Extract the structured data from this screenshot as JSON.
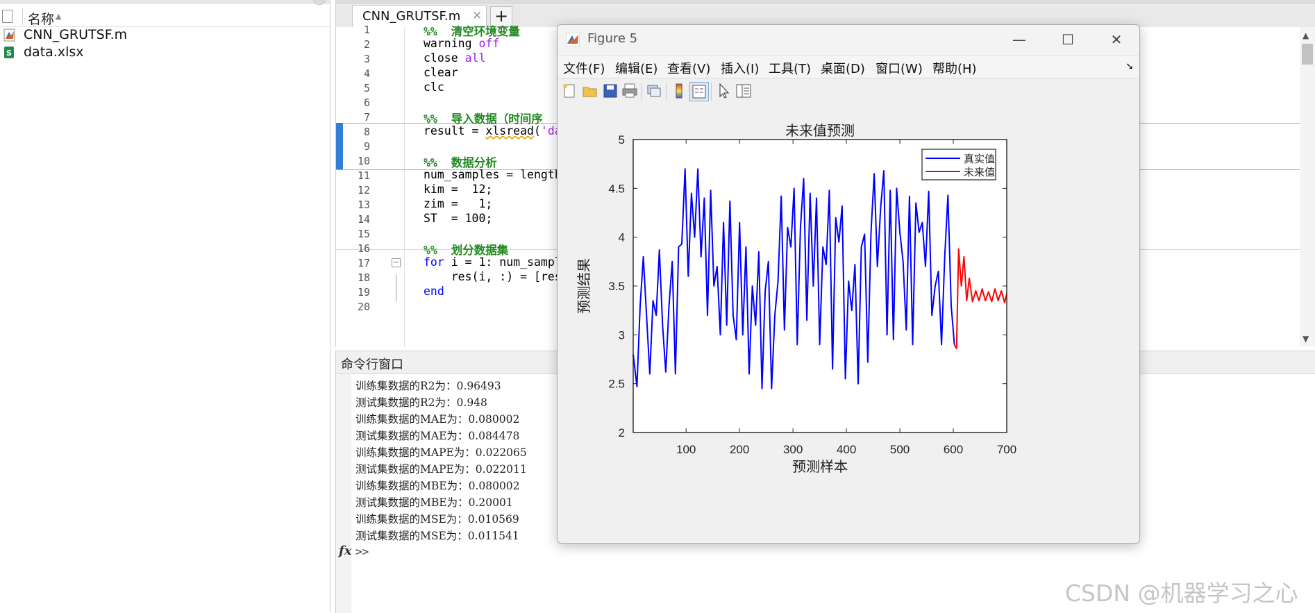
{
  "file_browser": {
    "column_header": "名称",
    "files": [
      {
        "name": "CNN_GRUTSF.m",
        "type": "matlab"
      },
      {
        "name": "data.xlsx",
        "type": "excel"
      }
    ]
  },
  "editor": {
    "active_tab": "CNN_GRUTSF.m",
    "tab_close": "✕",
    "tab_add": "+"
  },
  "command_window": {
    "title": "命令行窗口",
    "lines": [
      "训练集数据的R2为：0.96493",
      "测试集数据的R2为：0.948",
      "训练集数据的MAE为：0.080002",
      "测试集数据的MAE为：0.084478",
      "训练集数据的MAPE为：0.022065",
      "测试集数据的MAPE为：0.022011",
      "训练集数据的MBE为：0.080002",
      "测试集数据的MBE为：0.20001",
      "训练集数据的MSE为：0.010569",
      "测试集数据的MSE为：0.011541"
    ],
    "fx": "fx",
    "prompt": ">>"
  },
  "figure": {
    "title": "Figure 5",
    "menus": [
      "文件(F)",
      "编辑(E)",
      "查看(V)",
      "插入(I)",
      "工具(T)",
      "桌面(D)",
      "窗口(W)",
      "帮助(H)"
    ],
    "toolbar_icons": [
      "new-figure-icon",
      "open-icon",
      "save-icon",
      "print-icon",
      "link-icon",
      "colorbar-icon",
      "legend-icon",
      "pointer-icon",
      "property-inspector-icon"
    ]
  },
  "chart_data": {
    "type": "line",
    "title": "未来值预测",
    "xlabel": "预测样本",
    "ylabel": "预测结果",
    "xlim": [
      1,
      700
    ],
    "ylim": [
      2,
      5
    ],
    "xticks": [
      100,
      200,
      300,
      400,
      500,
      600,
      700
    ],
    "yticks": [
      2,
      2.5,
      3,
      3.5,
      4,
      4.5,
      5
    ],
    "legend_position": "top-right",
    "series": [
      {
        "name": "真实值",
        "color": "#0000ff",
        "x": [
          1,
          8,
          14,
          20,
          26,
          32,
          38,
          44,
          50,
          56,
          62,
          68,
          74,
          80,
          86,
          92,
          98,
          104,
          110,
          116,
          122,
          128,
          134,
          140,
          146,
          152,
          158,
          164,
          170,
          176,
          182,
          188,
          194,
          200,
          206,
          212,
          218,
          224,
          230,
          236,
          242,
          248,
          254,
          260,
          266,
          272,
          278,
          284,
          290,
          296,
          302,
          308,
          314,
          320,
          326,
          332,
          338,
          344,
          350,
          356,
          362,
          368,
          374,
          380,
          386,
          392,
          398,
          404,
          410,
          416,
          422,
          428,
          434,
          440,
          446,
          452,
          458,
          464,
          470,
          476,
          482,
          488,
          494,
          500,
          506,
          512,
          518,
          524,
          530,
          536,
          542,
          548,
          554,
          560,
          566,
          572,
          578,
          584,
          590,
          596,
          602
        ],
        "y": [
          2.8,
          2.47,
          3.3,
          3.8,
          3.2,
          2.6,
          3.35,
          3.2,
          3.87,
          3.1,
          2.62,
          3.3,
          3.75,
          2.6,
          3.9,
          3.93,
          4.7,
          3.6,
          4.45,
          4.0,
          4.7,
          3.8,
          4.4,
          3.2,
          4.48,
          3.5,
          3.7,
          3.0,
          4.15,
          3.1,
          4.37,
          3.2,
          2.95,
          4.15,
          3.0,
          3.9,
          2.6,
          3.5,
          3.1,
          3.85,
          2.45,
          3.45,
          3.75,
          2.45,
          3.2,
          3.55,
          4.42,
          3.05,
          4.1,
          3.9,
          4.5,
          2.9,
          4.1,
          4.6,
          3.15,
          4.45,
          3.5,
          4.4,
          2.9,
          3.9,
          3.72,
          4.48,
          2.65,
          4.2,
          3.95,
          4.32,
          2.55,
          3.55,
          3.25,
          3.72,
          2.5,
          3.9,
          4.03,
          2.72,
          4.05,
          4.65,
          3.7,
          4.3,
          4.68,
          3.0,
          4.48,
          2.95,
          4.5,
          4.05,
          3.75,
          3.05,
          4.42,
          2.9,
          4.35,
          4.05,
          4.15,
          3.7,
          4.47,
          3.2,
          3.5,
          3.65,
          2.9,
          3.8,
          4.43,
          3.3,
          2.9
        ]
      },
      {
        "name": "未来值",
        "color": "#ff0000",
        "x": [
          602,
          606,
          610,
          615,
          620,
          625,
          630,
          636,
          642,
          648,
          654,
          660,
          666,
          672,
          678,
          684,
          690,
          696,
          700
        ],
        "y": [
          2.9,
          2.86,
          3.88,
          3.5,
          3.8,
          3.35,
          3.58,
          3.34,
          3.45,
          3.35,
          3.47,
          3.35,
          3.44,
          3.34,
          3.47,
          3.35,
          3.45,
          3.33,
          3.42
        ]
      }
    ]
  },
  "watermark": "CSDN @机器学习之心"
}
